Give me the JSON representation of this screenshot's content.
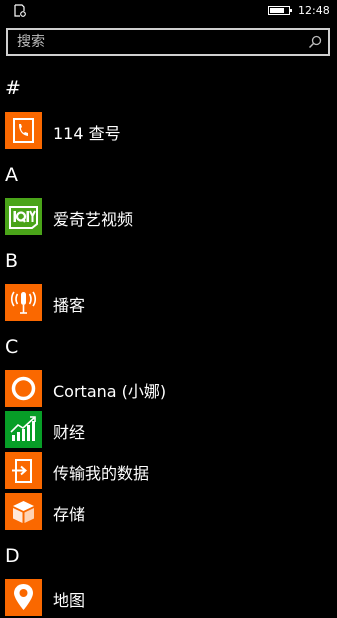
{
  "status_bar": {
    "time": "12:48",
    "battery_level": 0.8
  },
  "search": {
    "placeholder": "搜索"
  },
  "sections": [
    {
      "letter": "#",
      "apps": [
        {
          "label": "114 查号",
          "icon": "phone-book-icon",
          "color": "#fa6800"
        }
      ]
    },
    {
      "letter": "A",
      "apps": [
        {
          "label": "爱奇艺视频",
          "icon": "iqiyi-icon",
          "color": "#4aa419"
        }
      ]
    },
    {
      "letter": "B",
      "apps": [
        {
          "label": "播客",
          "icon": "podcast-microphone-icon",
          "color": "#fa6800"
        }
      ]
    },
    {
      "letter": "C",
      "apps": [
        {
          "label": "Cortana (小娜)",
          "icon": "cortana-ring-icon",
          "color": "#fa6800"
        },
        {
          "label": "财经",
          "icon": "finance-chart-icon",
          "color": "#079e27"
        },
        {
          "label": "传输我的数据",
          "icon": "transfer-data-icon",
          "color": "#fa6800"
        },
        {
          "label": "存储",
          "icon": "storage-box-icon",
          "color": "#fa6800"
        }
      ]
    },
    {
      "letter": "D",
      "apps": [
        {
          "label": "地图",
          "icon": "map-pin-icon",
          "color": "#fa6800"
        }
      ]
    }
  ]
}
